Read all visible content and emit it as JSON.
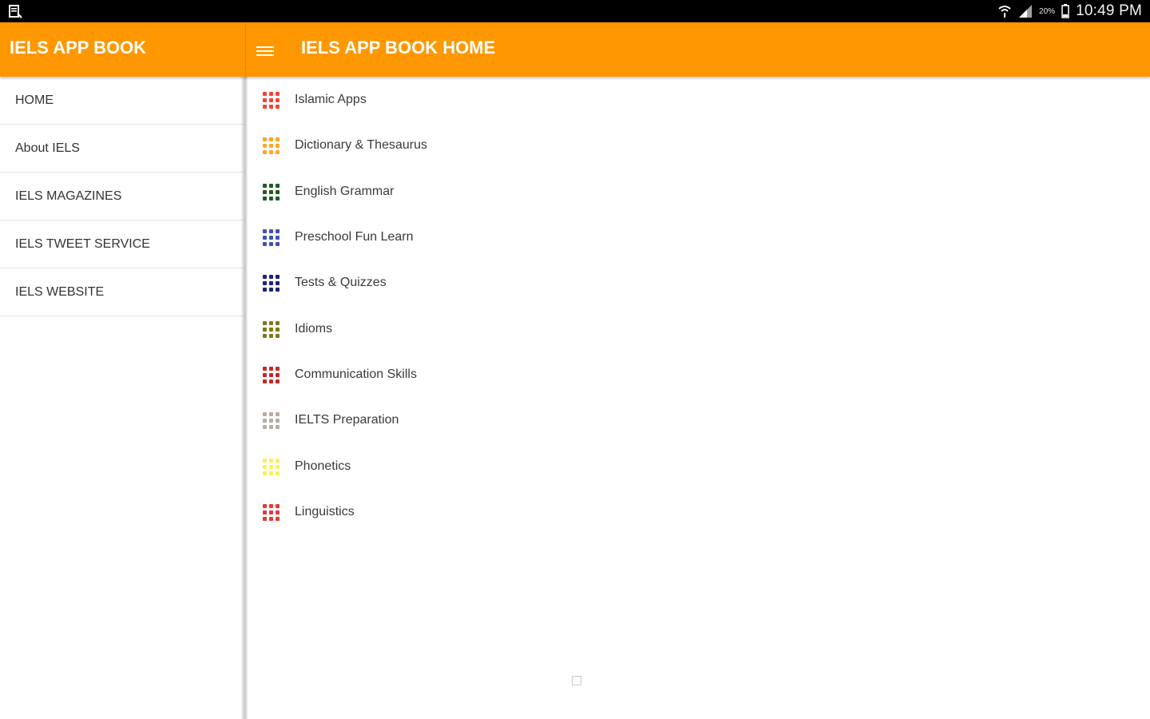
{
  "status_bar": {
    "battery_percent": "20%",
    "time": "10:49 PM"
  },
  "app_bar": {
    "drawer_title": "IELS APP BOOK",
    "screen_title": "IELS APP BOOK HOME",
    "accent_color": "#ff9800"
  },
  "drawer": {
    "items": [
      {
        "label": "HOME"
      },
      {
        "label": "About IELS"
      },
      {
        "label": "IELS MAGAZINES"
      },
      {
        "label": "IELS TWEET SERVICE"
      },
      {
        "label": "IELS WEBSITE"
      }
    ]
  },
  "list": {
    "items": [
      {
        "label": "Islamic Apps",
        "icon": "grid-icon",
        "color": "#f44336"
      },
      {
        "label": "Dictionary & Thesaurus",
        "icon": "grid-icon",
        "color": "#ffa726"
      },
      {
        "label": "English Grammar",
        "icon": "grid-icon",
        "color": "#1b5e20"
      },
      {
        "label": "Preschool Fun Learn",
        "icon": "grid-icon",
        "color": "#3f51b5"
      },
      {
        "label": "Tests & Quizzes",
        "icon": "grid-icon",
        "color": "#1a237e"
      },
      {
        "label": "Idioms",
        "icon": "grid-icon",
        "color": "#827717"
      },
      {
        "label": "Communication Skills",
        "icon": "grid-icon",
        "color": "#c62828"
      },
      {
        "label": "IELTS Preparation",
        "icon": "grid-icon",
        "color": "#bcaaa4"
      },
      {
        "label": "Phonetics",
        "icon": "grid-icon",
        "color": "#ffee58"
      },
      {
        "label": "Linguistics",
        "icon": "grid-icon",
        "color": "#e53935"
      }
    ]
  }
}
